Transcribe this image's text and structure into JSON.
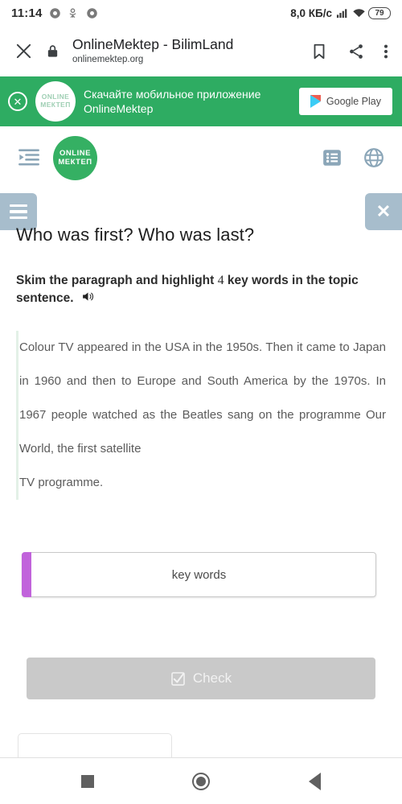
{
  "status_bar": {
    "time": "11:14",
    "icons": [
      "chrome-icon",
      "odnoklassniki-icon",
      "chrome-icon"
    ],
    "network_speed": "8,0 КБ/c",
    "signal_icon": "signal-bars-icon",
    "wifi_icon": "wifi-icon",
    "battery_level": "79"
  },
  "browser_bar": {
    "close_icon": "close-icon",
    "lock_icon": "lock-icon",
    "title": "OnlineMektep - BilimLand",
    "url": "onlinemektep.org",
    "bookmark_icon": "bookmark-icon",
    "share_icon": "share-icon",
    "menu_icon": "more-vertical-icon"
  },
  "app_banner": {
    "close_icon": "close-circle-icon",
    "logo_line1": "ONLINE",
    "logo_line2": "МЕКТЕП",
    "message": "Скачайте мобильное приложение OnlineMektep",
    "store_button": "Google Play",
    "background_color": "#2eac62"
  },
  "site_header": {
    "menu_icon": "indent-menu-icon",
    "logo_line1": "ONLINE",
    "logo_line2": "МЕКТЕП",
    "logo_color": "#35b063",
    "list_icon": "list-icon",
    "language_icon": "globe-icon"
  },
  "lesson": {
    "menu_button_icon": "hamburger-icon",
    "close_button_icon": "close-icon",
    "button_color": "#a7bdcc",
    "title": "Who was first? Who was last?",
    "task": {
      "part1": "Skim the paragraph and highlight ",
      "number": "4",
      "part2": " key words in the topic sentence.",
      "audio_icon": "speaker-icon"
    },
    "paragraph_lines": [
      "Colour TV appeared in the USA in the 1950s. Then",
      "it came to Japan in 1960 and then to Europe and",
      "South America by the 1970s. In 1967",
      "people watched as the Beatles sang on the",
      "programme Our World, the first satellite",
      "TV programme."
    ],
    "dropzone": {
      "label": "key words",
      "accent_color": "#c163db"
    },
    "check_button": {
      "label": "Check",
      "icon": "checkbox-icon",
      "disabled_color": "#c9c9c9"
    }
  },
  "nav_bar": {
    "recents_icon": "square-recents-icon",
    "home_icon": "circle-home-icon",
    "back_icon": "triangle-back-icon"
  }
}
